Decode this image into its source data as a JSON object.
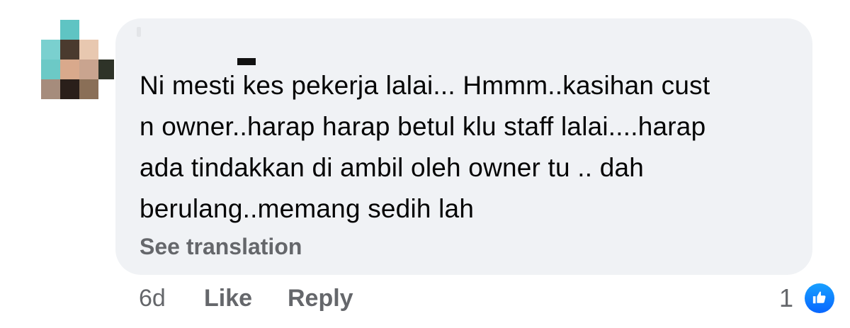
{
  "comment": {
    "lines": [
      "Ni mesti kes pekerja lalai... Hmmm..kasihan cust",
      "n owner..harap harap betul klu staff lalai....harap",
      "ada tindakkan di ambil oleh owner tu .. dah",
      "berulang..memang sedih lah"
    ],
    "see_translation": "See translation"
  },
  "actions": {
    "time": "6d",
    "like": "Like",
    "reply": "Reply"
  },
  "reactions": {
    "count": "1",
    "icon": "thumbs-up-icon"
  },
  "colors": {
    "bubble": "#f0f2f5",
    "text": "#050505",
    "secondary": "#65676b",
    "like_blue": "#0866ff"
  }
}
